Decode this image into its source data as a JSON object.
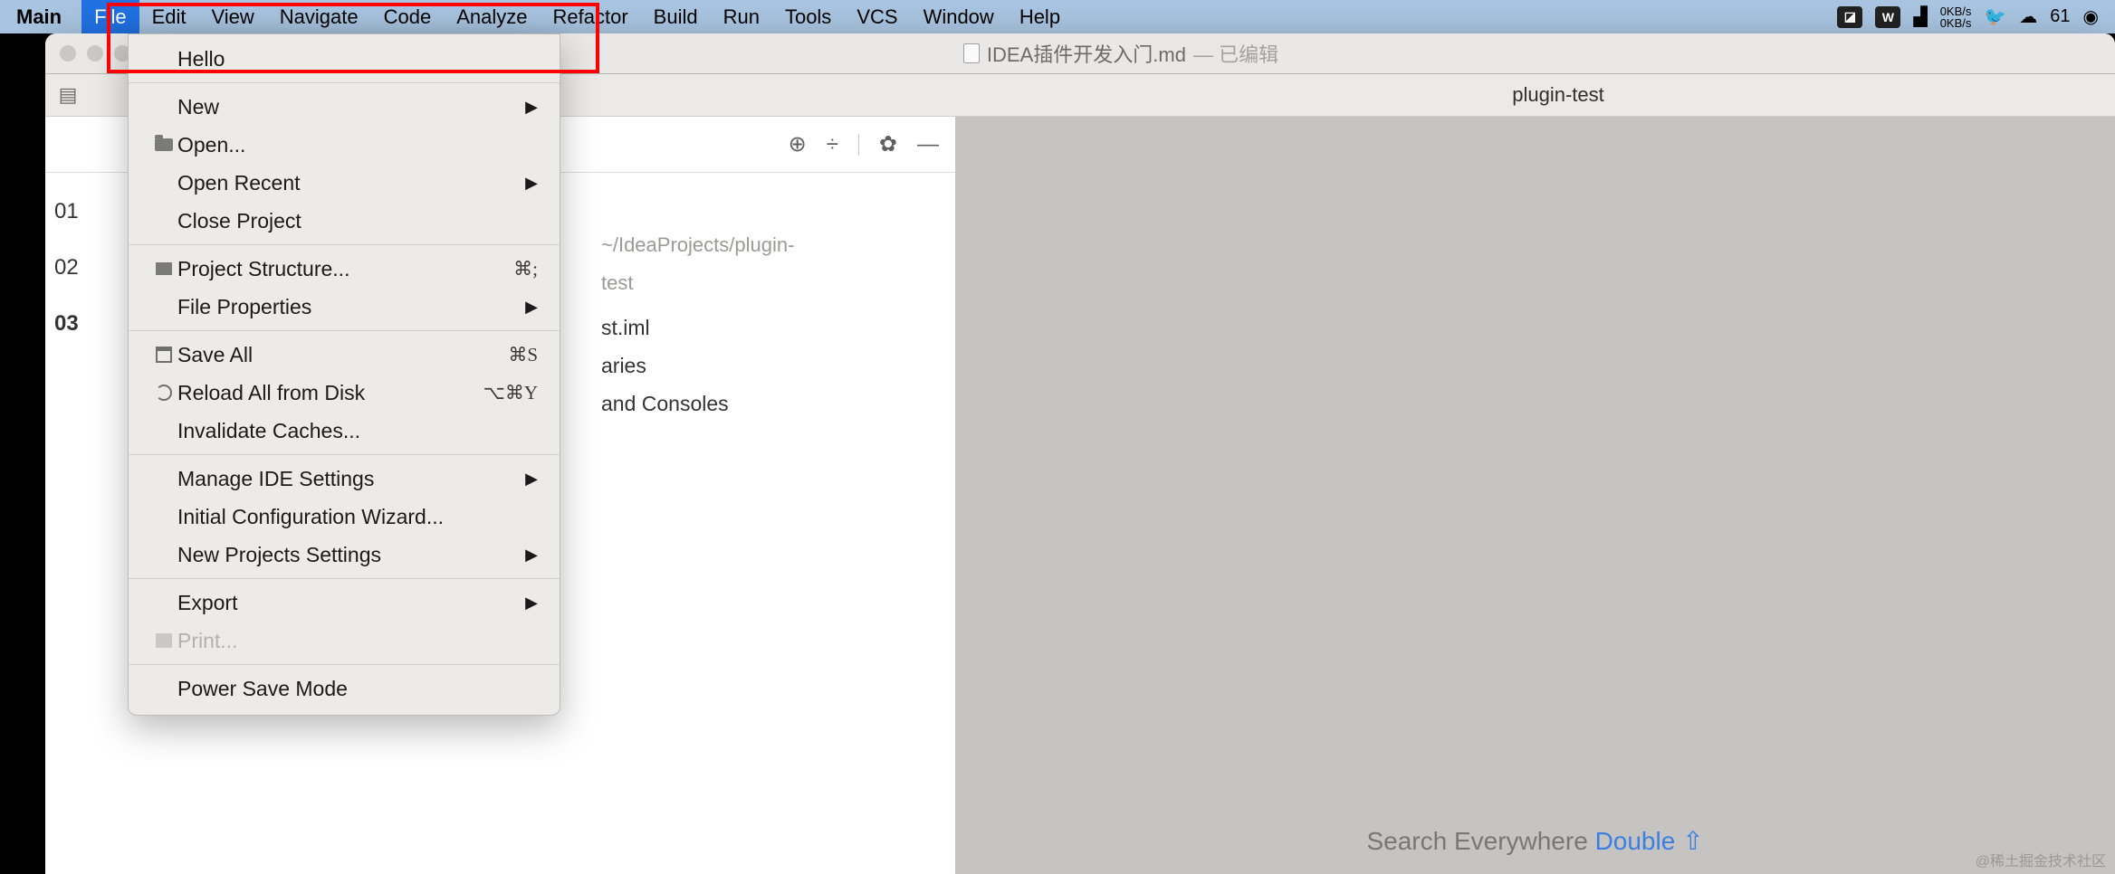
{
  "menubar": {
    "app": "Main",
    "items": [
      "File",
      "Edit",
      "View",
      "Navigate",
      "Code",
      "Analyze",
      "Refactor",
      "Build",
      "Run",
      "Tools",
      "VCS",
      "Window",
      "Help"
    ],
    "active_index": 0,
    "status": {
      "net_up": "0KB/s",
      "net_down": "0KB/s",
      "battery": "61"
    }
  },
  "titlebar": {
    "filename": "IDEA插件开发入门.md",
    "edited_suffix": "— 已编辑"
  },
  "breadcrumb": {
    "label": "plugin-test"
  },
  "gutter": {
    "lines": [
      "01",
      "02",
      "03"
    ],
    "current": 2
  },
  "project_tree": {
    "path": "~/IdeaProjects/plugin-test",
    "rows": [
      "st.iml",
      "aries",
      "and Consoles"
    ]
  },
  "file_menu": {
    "hello": "Hello",
    "new": "New",
    "open": "Open...",
    "open_recent": "Open Recent",
    "close_project": "Close Project",
    "project_structure": "Project Structure...",
    "project_structure_sc": "⌘;",
    "file_properties": "File Properties",
    "save_all": "Save All",
    "save_all_sc": "⌘S",
    "reload": "Reload All from Disk",
    "reload_sc": "⌥⌘Y",
    "invalidate": "Invalidate Caches...",
    "manage_ide": "Manage IDE Settings",
    "initial_config": "Initial Configuration Wizard...",
    "new_projects": "New Projects Settings",
    "export": "Export",
    "print": "Print...",
    "power_save": "Power Save Mode"
  },
  "search_hint": {
    "prefix": "Search Everywhere",
    "action": "Double",
    "key": "⇧"
  },
  "watermark": "@稀土掘金技术社区"
}
